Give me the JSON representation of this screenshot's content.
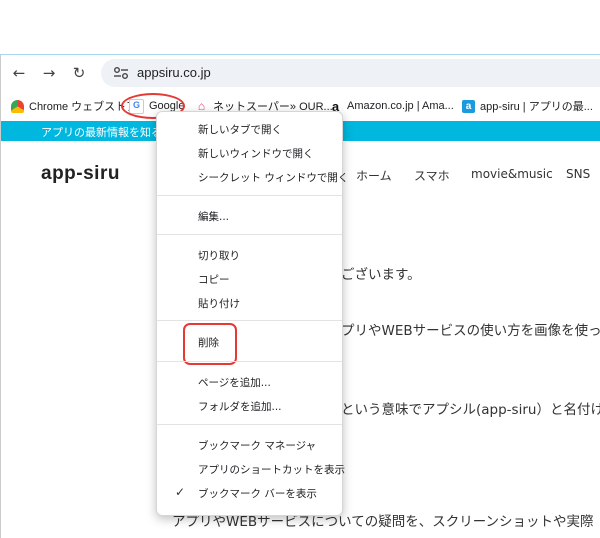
{
  "browser": {
    "url": "appsiru.co.jp",
    "nav": {
      "back": "←",
      "forward": "→",
      "reload": "↻"
    }
  },
  "bookmarks_bar": {
    "items": [
      {
        "label": "Chrome ウェブストア",
        "icon": "chrome-webstore-icon"
      },
      {
        "label": "Google",
        "icon": "google-icon"
      },
      {
        "label": "ネットスーパー» OUR...",
        "icon": "home-icon"
      },
      {
        "label": "Amazon.co.jp | Ama...",
        "icon": "amazon-icon"
      },
      {
        "label": "app-siru | アプリの最...",
        "icon": "app-siru-icon"
      }
    ]
  },
  "site": {
    "banner": "アプリの最新情報を知る",
    "logo": "app-siru",
    "nav": [
      "ホーム",
      "スマホ",
      "movie&music",
      "SNS"
    ],
    "paragraphs": [
      "ございます。",
      "プリやWEBサービスの使い方を画像を使っ",
      "という意味でアプシル(app-siru）と名付け",
      "アプリやWEBサービスについての疑問を、スクリーンショットや実際"
    ]
  },
  "context_menu": {
    "groups": [
      [
        "新しいタブで開く",
        "新しいウィンドウで開く",
        "シークレット ウィンドウで開く"
      ],
      [
        "編集..."
      ],
      [
        "切り取り",
        "コピー",
        "貼り付け"
      ],
      [
        "削除"
      ],
      [
        "ページを追加...",
        "フォルダを追加..."
      ],
      [
        "ブックマーク マネージャ",
        "アプリのショートカットを表示",
        "ブックマーク バーを表示"
      ]
    ],
    "checked_item": "ブックマーク バーを表示"
  },
  "colors": {
    "accent_banner": "#00b7e0",
    "annotation_red": "#e53935"
  }
}
